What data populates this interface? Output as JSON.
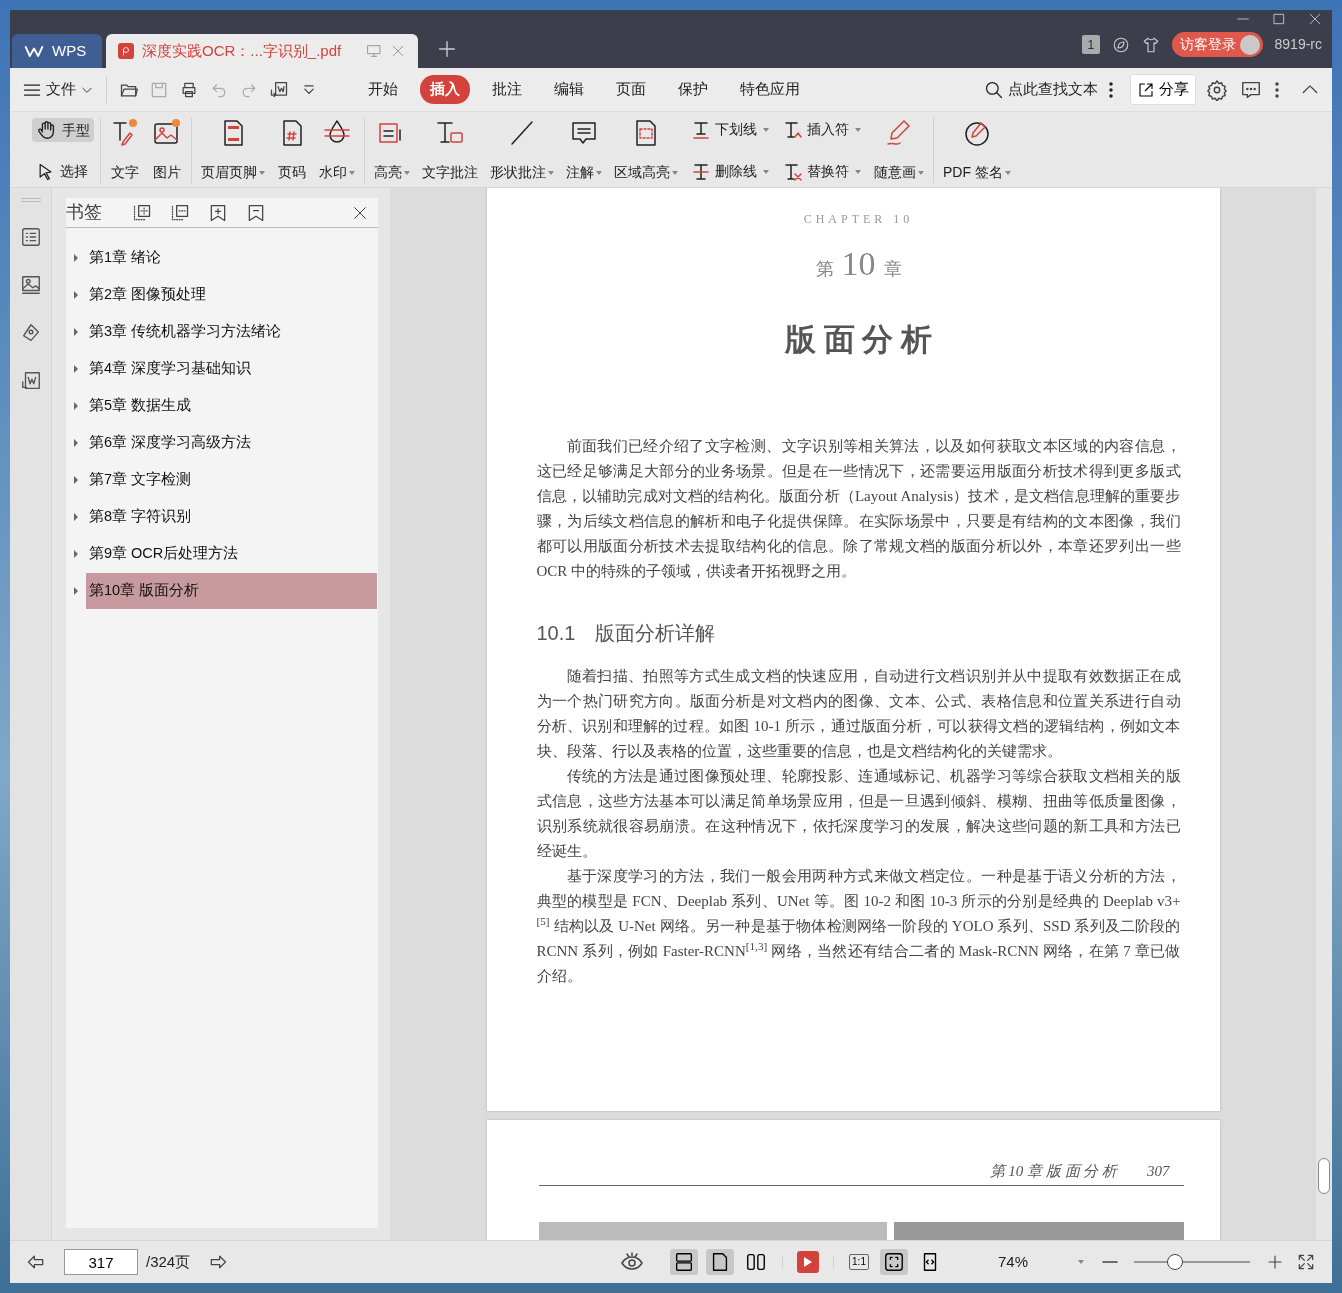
{
  "title_bar": {
    "tabs": [
      {
        "label": "WPS",
        "kind": "home",
        "selected": false
      },
      {
        "label": "深度实践OCR：...字识别_.pdf",
        "kind": "doc",
        "selected": true
      }
    ],
    "badge": "1",
    "login": "访客登录",
    "user": "8919-rc"
  },
  "menu": {
    "file": "文件",
    "tabs": [
      {
        "label": "开始",
        "selected": false
      },
      {
        "label": "插入",
        "selected": true
      },
      {
        "label": "批注",
        "selected": false
      },
      {
        "label": "编辑",
        "selected": false
      },
      {
        "label": "页面",
        "selected": false
      },
      {
        "label": "保护",
        "selected": false
      },
      {
        "label": "特色应用",
        "selected": false
      }
    ],
    "search": "点此查找文本",
    "share": "分享"
  },
  "toolbar": {
    "groups": [
      [
        {
          "label": "手型",
          "kind": "small",
          "selected": true,
          "dropdown": false
        },
        {
          "label": "选择",
          "kind": "small",
          "selected": false,
          "dropdown": false
        }
      ],
      [
        {
          "label": "文字",
          "kind": "big",
          "dropdown": false
        },
        {
          "label": "图片",
          "kind": "big",
          "dropdown": false
        }
      ],
      [
        {
          "label": "页眉页脚",
          "kind": "big",
          "dropdown": true
        },
        {
          "label": "页码",
          "kind": "big",
          "dropdown": false
        },
        {
          "label": "水印",
          "kind": "big",
          "dropdown": true
        }
      ],
      [
        {
          "label": "高亮",
          "kind": "big",
          "dropdown": true
        },
        {
          "label": "文字批注",
          "kind": "big",
          "dropdown": false
        },
        {
          "label": "形状批注",
          "kind": "big",
          "dropdown": true
        },
        {
          "label": "注解",
          "kind": "big",
          "dropdown": true
        },
        {
          "label": "区域高亮",
          "kind": "big",
          "dropdown": true
        },
        {
          "label": "下划线",
          "kind": "small",
          "dropdown": true
        },
        {
          "label": "删除线",
          "kind": "small",
          "dropdown": true
        },
        {
          "label": "插入符",
          "kind": "small",
          "dropdown": true
        },
        {
          "label": "替换符",
          "kind": "small",
          "dropdown": true
        },
        {
          "label": "随意画",
          "kind": "big",
          "dropdown": true
        }
      ],
      [
        {
          "label": "PDF 签名",
          "kind": "big",
          "dropdown": true
        }
      ]
    ]
  },
  "bookmarks": {
    "title": "书签",
    "items": [
      {
        "label": "第1章 绪论",
        "selected": false,
        "expanded": false
      },
      {
        "label": "第2章 图像预处理",
        "selected": false,
        "expanded": false
      },
      {
        "label": "第3章 传统机器学习方法绪论",
        "selected": false,
        "expanded": false
      },
      {
        "label": "第4章 深度学习基础知识",
        "selected": false,
        "expanded": false
      },
      {
        "label": "第5章 数据生成",
        "selected": false,
        "expanded": false
      },
      {
        "label": "第6章 深度学习高级方法",
        "selected": false,
        "expanded": false
      },
      {
        "label": "第7章 文字检测",
        "selected": false,
        "expanded": false
      },
      {
        "label": "第8章 字符识别",
        "selected": false,
        "expanded": false
      },
      {
        "label": "第9章 OCR后处理方法",
        "selected": false,
        "expanded": false
      },
      {
        "label": "第10章 版面分析",
        "selected": true,
        "expanded": false
      }
    ]
  },
  "document": {
    "page_1": {
      "chapter_label": "CHAPTER 10",
      "chapter_prefix": "第",
      "chapter_number": "10",
      "chapter_suffix": "章",
      "title": "版 面 分 析",
      "intro": "前面我们已经介绍了文字检测、文字识别等相关算法，以及如何获取文本区域的内容信息，这已经足够满足大部分的业务场景。但是在一些情况下，还需要运用版面分析技术得到更多版式信息，以辅助完成对文档的结构化。版面分析（Layout Analysis）技术，是文档信息理解的重要步骤，为后续文档信息的解析和电子化提供保障。在实际场景中，只要是有结构的文本图像，我们都可以用版面分析技术去提取结构化的信息。除了常规文档的版面分析以外，本章还罗列出一些 OCR 中的特殊的子领域，供读者开拓视野之用。",
      "section_number": "10.1",
      "section_title": "版面分析详解",
      "paragraphs": [
        "随着扫描、拍照等方式生成文档的快速应用，自动进行文档识别并从中提取有效数据正在成为一个热门研究方向。版面分析是对文档内的图像、文本、公式、表格信息和位置关系进行自动分析、识别和理解的过程。如图 10-1 所示，通过版面分析，可以获得文档的逻辑结构，例如文本块、段落、行以及表格的位置，这些重要的信息，也是文档结构化的关键需求。",
        "传统的方法是通过图像预处理、轮廓投影、连通域标记、机器学习等综合获取文档相关的版式信息，这些方法基本可以满足简单场景应用，但是一旦遇到倾斜、模糊、扭曲等低质量图像，识别系统就很容易崩溃。在这种情况下，依托深度学习的发展，解决这些问题的新工具和方法已经诞生。",
        "基于深度学习的方法，我们一般会用两种方式来做文档定位。一种是基于语义分析的方法，典型的模型是 FCN、Deeplab 系列、UNet 等。图 10-2 和图 10-3 所示的分别是经典的 Deeplab v3+$^{[5]}$ 结构以及 U-Net 网络。另一种是基于物体检测网络一阶段的 YOLO 系列、SSD 系列及二阶段的 RCNN 系列，例如 Faster-RCNN$^{[1,3]}$ 网络，当然还有结合二者的 Mask-RCNN 网络，在第 7 章已做介绍。"
      ]
    },
    "page_2": {
      "running_head": "第 10 章  版 面 分 析",
      "page_number": "307"
    }
  },
  "status_bar": {
    "page": "317",
    "total": "/324页",
    "view_modes": [
      {
        "kind": "continuous",
        "selected": true
      },
      {
        "kind": "single",
        "selected": true
      },
      {
        "kind": "double",
        "selected": false
      }
    ],
    "actual_size": "1:1",
    "fit_modes": [
      {
        "kind": "fit-page",
        "selected": true
      },
      {
        "kind": "fit-width",
        "selected": false
      }
    ],
    "zoom": "74%",
    "zoom_slider": {
      "level": 0.35
    }
  }
}
